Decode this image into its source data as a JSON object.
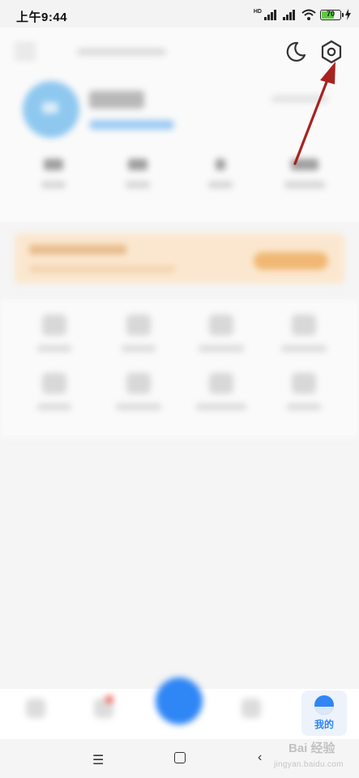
{
  "status_bar": {
    "time": "上午9:44",
    "hd_label": "HD",
    "battery_level": "70",
    "battery_fill_percent": 70
  },
  "bottom_nav": {
    "active_tab_label": "我的",
    "accent_color": "#2f86f5"
  },
  "system_nav": {
    "menu_glyph": "☰",
    "back_glyph": "‹"
  },
  "watermark": {
    "brand": "Bai 经验",
    "url": "jingyan.baidu.com"
  },
  "annotation": {
    "arrow_color": "#a8221f",
    "target": "settings-icon"
  }
}
